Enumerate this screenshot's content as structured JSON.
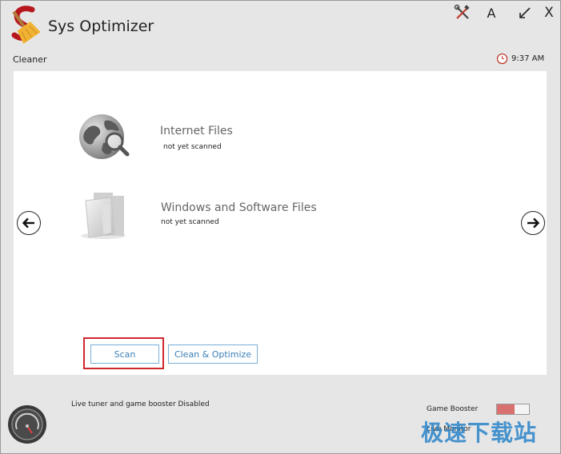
{
  "app": {
    "title": "Sys Optimizer",
    "section": "Cleaner",
    "clock_time": "9:37 AM"
  },
  "titlebar": {
    "font_label": "A",
    "close_label": "X"
  },
  "items": [
    {
      "title": "Internet Files",
      "status": "not yet scanned",
      "icon": "globe-search-icon"
    },
    {
      "title": "Windows and Software Files",
      "status": "not yet scanned",
      "icon": "folder-icon"
    }
  ],
  "buttons": {
    "scan": "Scan",
    "clean": "Clean & Optimize"
  },
  "footer": {
    "status": "Live tuner and game booster Disabled",
    "game_booster_label": "Game Booster",
    "live_monitor_label": "Live Monitor"
  },
  "watermark": "极速下载站",
  "colors": {
    "accent_blue": "#3b7fb6",
    "highlight_red": "#d0272d",
    "toggle_red": "#d97070",
    "logo_red": "#b5171d"
  }
}
